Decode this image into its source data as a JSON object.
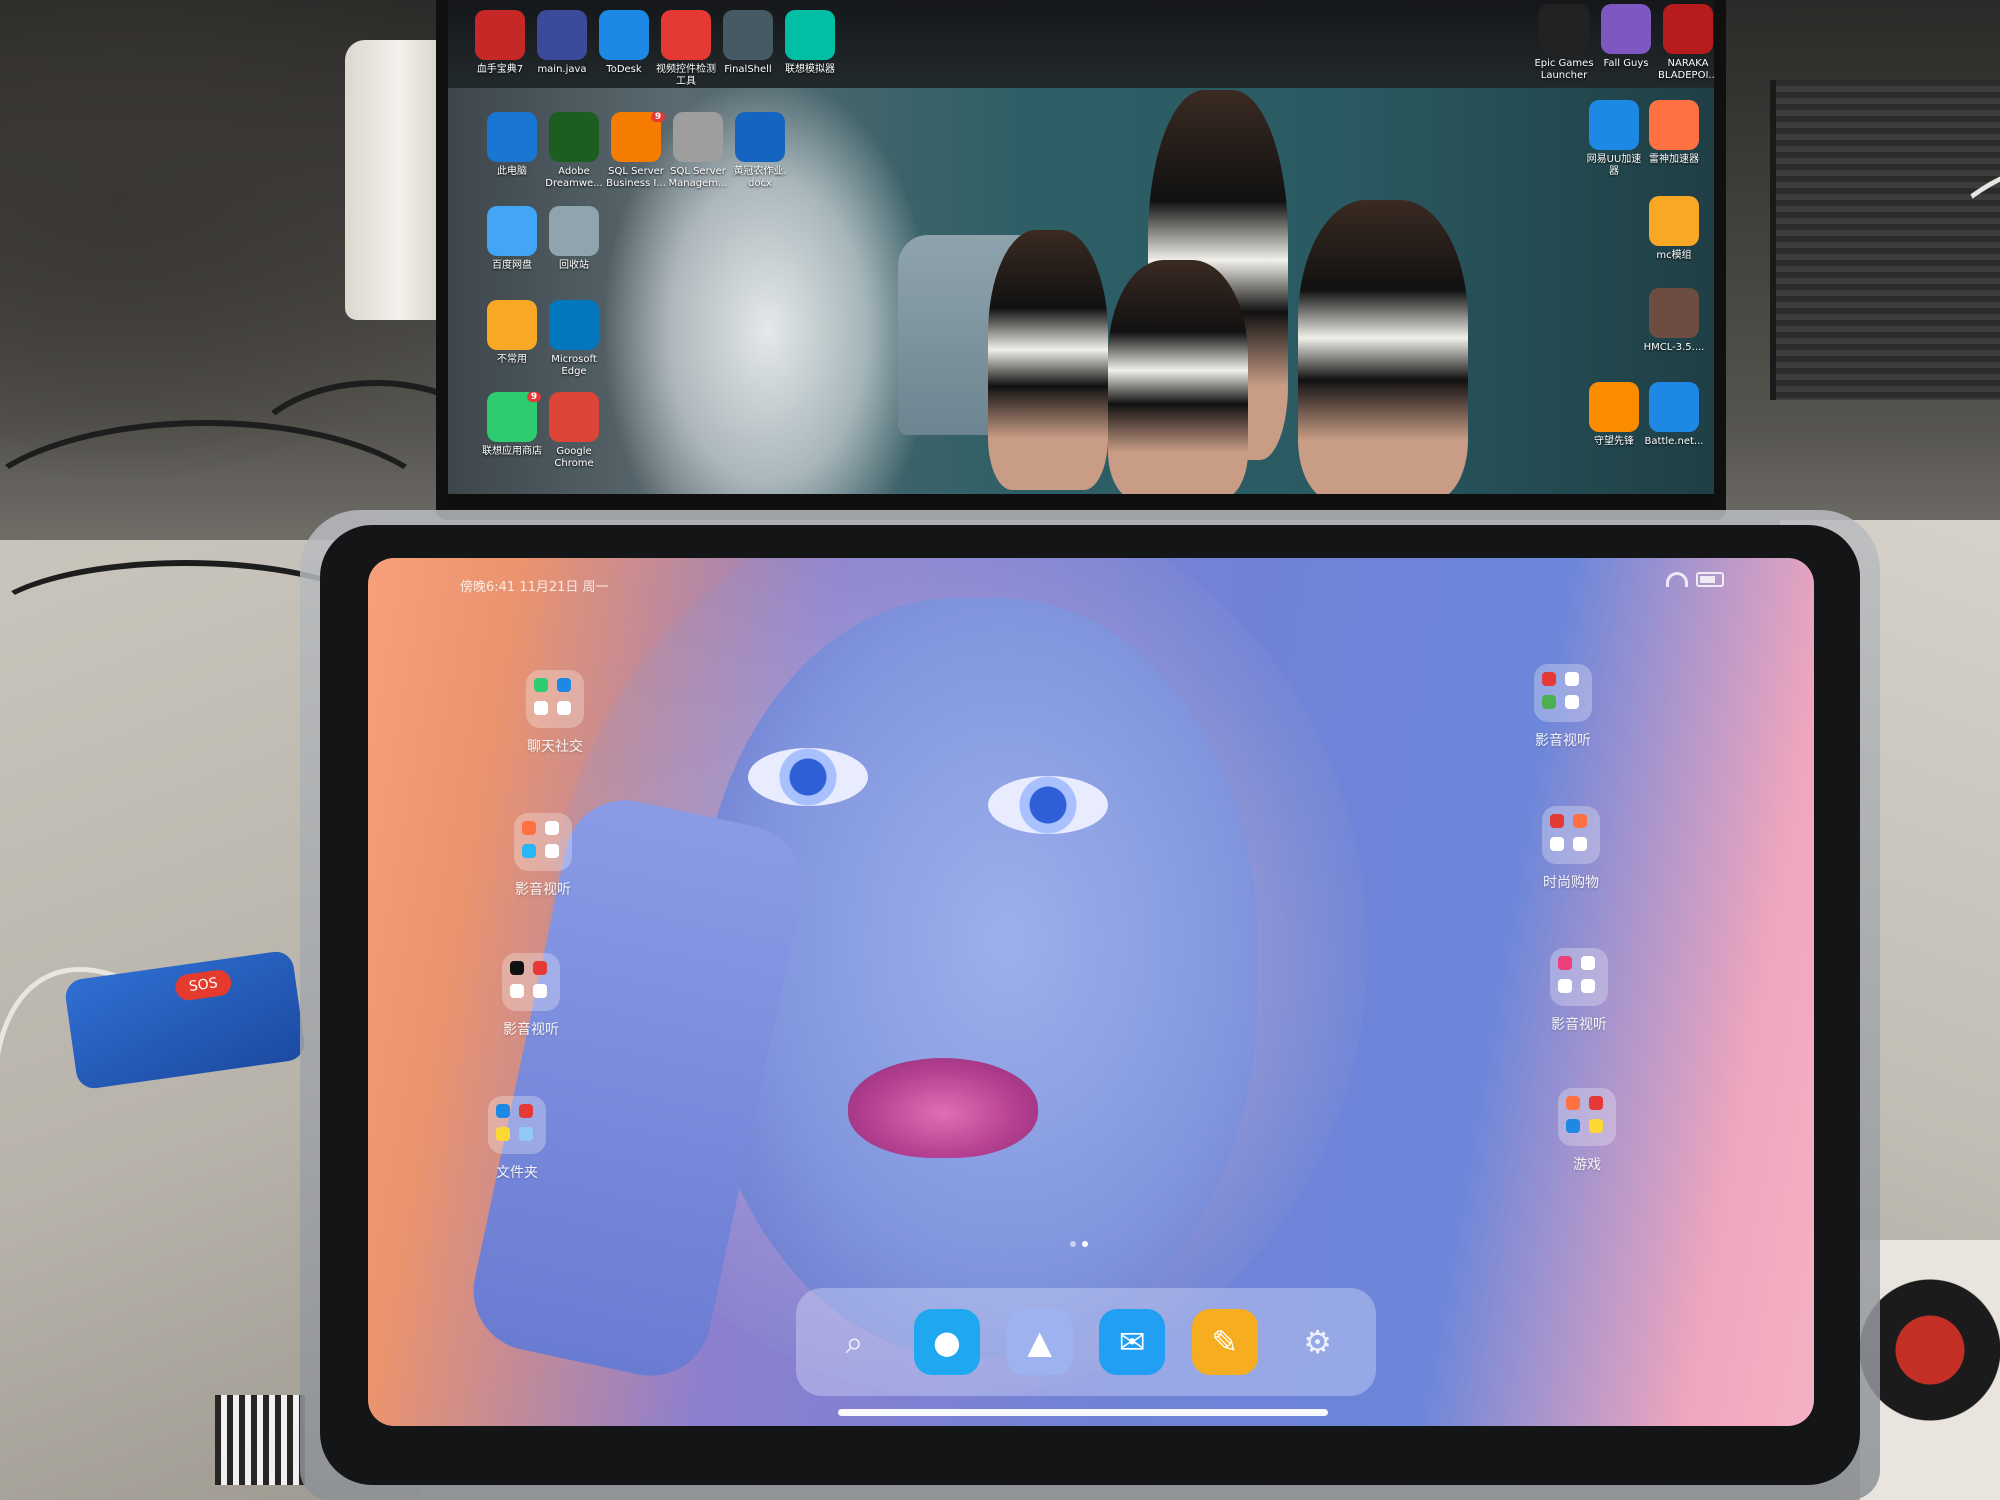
{
  "monitor": {
    "top_icons": [
      {
        "label": "血手宝典7",
        "icon": "blood-hand-icon",
        "color": "#c62828"
      },
      {
        "label": "main.java",
        "icon": "eclipse-icon",
        "color": "#3b4a9b"
      },
      {
        "label": "ToDesk",
        "icon": "todesk-icon",
        "color": "#1e88e5"
      },
      {
        "label": "视频控件检测\n工具",
        "icon": "video-tool-icon",
        "color": "#e53935"
      },
      {
        "label": "FinalShell",
        "icon": "finalshell-icon",
        "color": "#455a64"
      },
      {
        "label": "联想模拟器",
        "icon": "emulator-icon",
        "color": "#00bfa5"
      }
    ],
    "top_right_icons": [
      {
        "label": "Epic Games\nLauncher",
        "icon": "epic-games-icon",
        "color": "#222222"
      },
      {
        "label": "Fall Guys",
        "icon": "fall-guys-icon",
        "color": "#7e57c2"
      },
      {
        "label": "NARAKA\nBLADEPOI...",
        "icon": "naraka-icon",
        "color": "#b71c1c"
      }
    ],
    "left_icons": [
      {
        "label": "此电脑",
        "icon": "this-pc-icon",
        "color": "#1976d2"
      },
      {
        "label": "Adobe\nDreamwe...",
        "icon": "dreamweaver-icon",
        "color": "#1b5e20"
      },
      {
        "label": "SQL Server\nBusiness I...",
        "icon": "sql-server-bi-icon",
        "color": "#f57c00"
      },
      {
        "label": "SQL Server\nManagem...",
        "icon": "sql-server-management-icon",
        "color": "#9e9e9e"
      },
      {
        "label": "黄冠农作业.\ndocx",
        "icon": "word-doc-icon",
        "color": "#1565c0"
      },
      {
        "label": "百度网盘",
        "icon": "baidu-netdisk-icon",
        "color": "#42a5f5"
      },
      {
        "label": "回收站",
        "icon": "recycle-bin-icon",
        "color": "#90a4ae"
      },
      {
        "label": "不常用",
        "icon": "folder-icon",
        "color": "#f9a825"
      },
      {
        "label": "Microsoft\nEdge",
        "icon": "edge-icon",
        "color": "#0277bd"
      },
      {
        "label": "联想应用商店",
        "icon": "lenovo-store-icon",
        "color": "#2ecc71"
      },
      {
        "label": "Google\nChrome",
        "icon": "chrome-icon",
        "color": "#db4437"
      }
    ],
    "right_icons": [
      {
        "label": "网易UU加速\n器",
        "icon": "uu-accelerator-icon",
        "color": "#1e88e5"
      },
      {
        "label": "雷神加速器",
        "icon": "leishen-icon",
        "color": "#ff7043"
      },
      {
        "label": "mc模组",
        "icon": "folder-icon",
        "color": "#f9a825"
      },
      {
        "label": "HMCL-3.5....",
        "icon": "minecraft-icon",
        "color": "#6d4c41"
      },
      {
        "label": "守望先锋",
        "icon": "overwatch-icon",
        "color": "#fb8c00"
      },
      {
        "label": "Battle.net...",
        "icon": "battlenet-icon",
        "color": "#1e88e5"
      }
    ],
    "badges": {
      "store": "9",
      "sql": "9"
    }
  },
  "tablet": {
    "status_time": "傍晚6:41  11月21日 周一",
    "folders_left": [
      {
        "name": "聊天社交",
        "colors": [
          "#2ecc71",
          "#1e88e5",
          "#ffffff",
          "#ffffff"
        ]
      },
      {
        "name": "影音视听",
        "colors": [
          "#ff7043",
          "#ffffff",
          "#29b6f6",
          "#ffffff"
        ]
      },
      {
        "name": "影音视听",
        "colors": [
          "#111111",
          "#e53935",
          "#ffffff",
          "#ffffff"
        ]
      },
      {
        "name": "文件夹",
        "colors": [
          "#1e88e5",
          "#e53935",
          "#fdd835",
          "#90caf9"
        ]
      }
    ],
    "folders_right": [
      {
        "name": "影音视听",
        "colors": [
          "#e53935",
          "#ffffff",
          "#4caf50",
          "#ffffff"
        ]
      },
      {
        "name": "时尚购物",
        "colors": [
          "#e53935",
          "#ff7043",
          "#ffffff",
          "#ffffff"
        ]
      },
      {
        "name": "影音视听",
        "colors": [
          "#ec407a",
          "#ffffff",
          "#ffffff",
          "#ffffff"
        ]
      },
      {
        "name": "游戏",
        "colors": [
          "#ff7043",
          "#e53935",
          "#1e88e5",
          "#fdd835"
        ]
      }
    ],
    "dock": [
      {
        "icon": "search-icon",
        "glyph": "⌕",
        "color": "#c9cbe0"
      },
      {
        "icon": "messages-icon",
        "glyph": "●",
        "color": "#1fa8f0"
      },
      {
        "icon": "gallery-icon",
        "glyph": "▲",
        "color": "#9fb2f0"
      },
      {
        "icon": "mail-icon",
        "glyph": "✉",
        "color": "#21a0f3"
      },
      {
        "icon": "notes-icon",
        "glyph": "✎",
        "color": "#f6ad1f"
      },
      {
        "icon": "settings-icon",
        "glyph": "⚙",
        "color": "#c9cbe0"
      }
    ],
    "page": {
      "count": 2,
      "active": 2
    }
  },
  "device": {
    "badge": "SOS"
  }
}
